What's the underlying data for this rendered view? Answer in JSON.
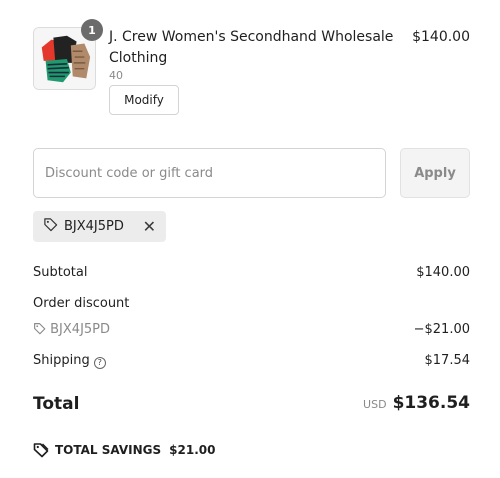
{
  "line_item": {
    "quantity": "1",
    "title": "J. Crew Women's Secondhand Wholesale Clothing",
    "variant": "40",
    "price": "$140.00",
    "modify_label": "Modify",
    "thumbnail_icon": "clothing-bundle-image"
  },
  "discount": {
    "placeholder": "Discount code or gift card",
    "value": "",
    "apply_label": "Apply",
    "applied_code": "BJX4J5PD"
  },
  "summary": {
    "subtotal_label": "Subtotal",
    "subtotal_value": "$140.00",
    "order_discount_label": "Order discount",
    "discount_code": "BJX4J5PD",
    "discount_value": "−$21.00",
    "shipping_label": "Shipping",
    "shipping_value": "$17.54",
    "total_label": "Total",
    "currency": "USD",
    "total_value": "$136.54",
    "savings_label": "TOTAL SAVINGS",
    "savings_value": "$21.00"
  },
  "colors": {
    "text": "#1f1f1f",
    "muted": "#8a8a8a",
    "badge": "#6b6b6b",
    "chip_bg": "#ececec"
  }
}
